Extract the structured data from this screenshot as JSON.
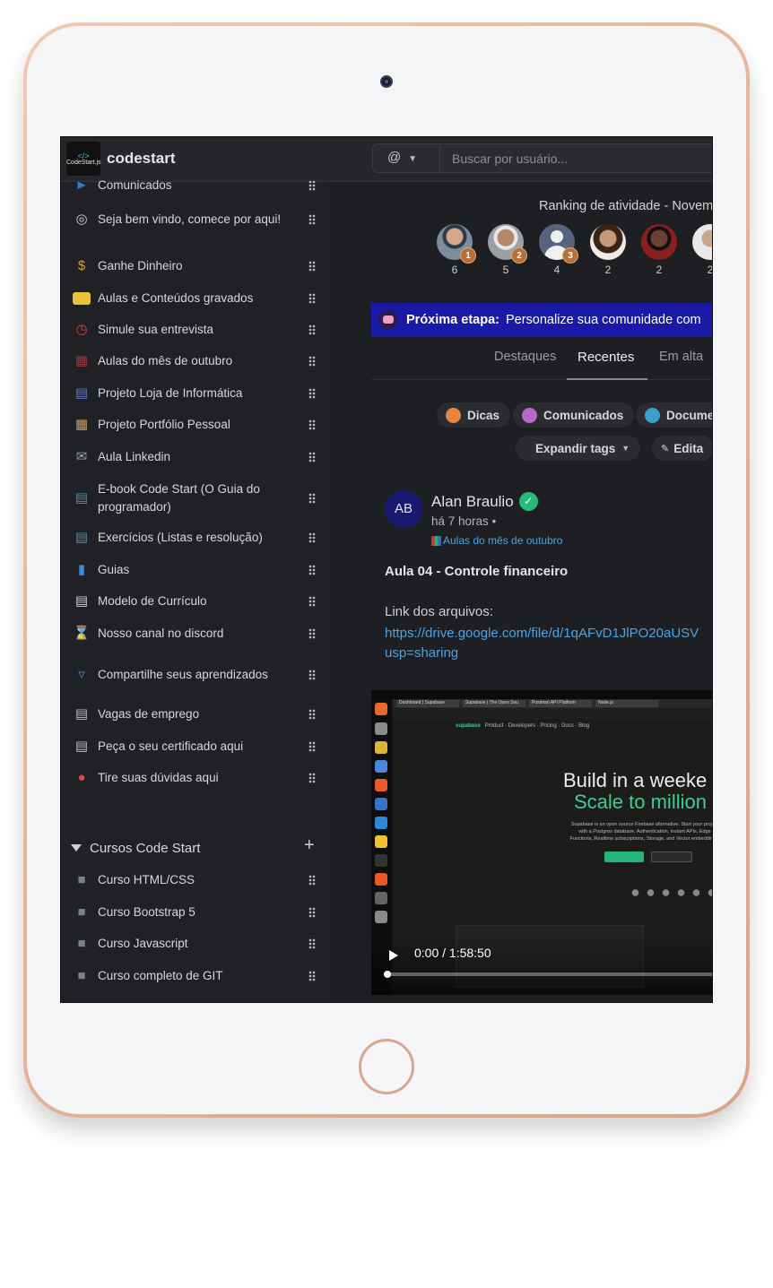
{
  "app": {
    "name": "codestart",
    "logo_text": "CodeStart.js"
  },
  "search": {
    "type_label": "@",
    "placeholder": "Buscar por usuário..."
  },
  "sidebar": {
    "items": [
      {
        "label": "Comunicados",
        "icon": "megaphone-icon"
      },
      {
        "label": "Seja bem vindo, comece por aqui!",
        "icon": "target-icon"
      },
      {
        "label": "Ganhe Dinheiro",
        "icon": "money-bag-icon"
      },
      {
        "label": "Aulas e Conteúdos gravados",
        "icon": "folder-icon"
      },
      {
        "label": "Simule sua entrevista",
        "icon": "alarm-clock-icon"
      },
      {
        "label": "Aulas do mês de outubro",
        "icon": "calendar-grid-icon"
      },
      {
        "label": "Projeto Loja de Informática",
        "icon": "computer-shop-icon"
      },
      {
        "label": "Projeto Portfólio Pessoal",
        "icon": "portfolio-icon"
      },
      {
        "label": "Aula Linkedin",
        "icon": "linkedin-icon"
      },
      {
        "label": "E-book Code Start (O Guia do programador)",
        "icon": "ebook-icon"
      },
      {
        "label": "Exercícios (Listas e resolução)",
        "icon": "exercise-icon"
      },
      {
        "label": "Guias",
        "icon": "guide-book-icon"
      },
      {
        "label": "Modelo de Currículo",
        "icon": "document-icon"
      },
      {
        "label": "Nosso canal no discord",
        "icon": "hourglass-icon"
      },
      {
        "label": "Compartilhe seus aprendizados",
        "icon": "funnel-icon"
      },
      {
        "label": "Vagas de emprego",
        "icon": "notepad-icon"
      },
      {
        "label": "Peça o seu certificado aqui",
        "icon": "certificate-icon"
      },
      {
        "label": "Tire suas dúvidas aqui",
        "icon": "pill-icon"
      }
    ],
    "section": {
      "title": "Cursos Code Start",
      "items": [
        {
          "label": "Curso HTML/CSS",
          "icon": "monitor-icon"
        },
        {
          "label": "Curso Bootstrap 5",
          "icon": "monitor-icon"
        },
        {
          "label": "Curso Javascript",
          "icon": "monitor-icon"
        },
        {
          "label": "Curso completo de GIT",
          "icon": "monitor-icon"
        }
      ]
    }
  },
  "ranking": {
    "title": "Ranking de atividade - Novem",
    "users": [
      {
        "score": "6",
        "medal": "1"
      },
      {
        "score": "5",
        "medal": "2"
      },
      {
        "score": "4",
        "medal": "3"
      },
      {
        "score": "2",
        "medal": ""
      },
      {
        "score": "2",
        "medal": ""
      },
      {
        "score": "2",
        "medal": ""
      }
    ]
  },
  "banner": {
    "label": "Próxima etapa:",
    "text": "Personalize sua comunidade com"
  },
  "tabs": [
    {
      "label": "Destaques",
      "active": false
    },
    {
      "label": "Recentes",
      "active": true
    },
    {
      "label": "Em alta",
      "active": false
    }
  ],
  "tags": {
    "items": [
      {
        "label": "Dicas"
      },
      {
        "label": "Comunicados"
      },
      {
        "label": "Docume"
      }
    ],
    "expand_label": "Expandir tags",
    "edit_label": "Edita"
  },
  "post": {
    "avatar_initials": "AB",
    "author": "Alan Braulio",
    "time": "há 7 horas •",
    "channel": "Aulas do mês de outubro",
    "title": "Aula 04 - Controle financeiro",
    "text": "Link dos arquivos:",
    "link_line1": "https://drive.google.com/file/d/1qAFvD1JlPO20aUSV",
    "link_line2": "usp=sharing"
  },
  "video": {
    "time": "0:00 / 1:58:50",
    "progress": 0,
    "headline1": "Build in a weeke",
    "headline2": "Scale to million",
    "brand": "supabase",
    "nav": "Product · Developers · Pricing · Docs · Blog",
    "subtitle": "Supabase is an open source Firebase alternative. Start your project with a Postgres database, Authentication, instant APIs, Edge Functions, Realtime subscriptions, Storage, and Vector embeddings.",
    "tab_labels": [
      "Dashboard | Supabase",
      "Supabase | The Open Sou",
      "Postman API Platform",
      "Node.js"
    ]
  },
  "colors": {
    "accent": "#1a1aa6",
    "link": "#4aa3e3",
    "verified": "#1fbf7a",
    "background": "#1e1f22"
  }
}
